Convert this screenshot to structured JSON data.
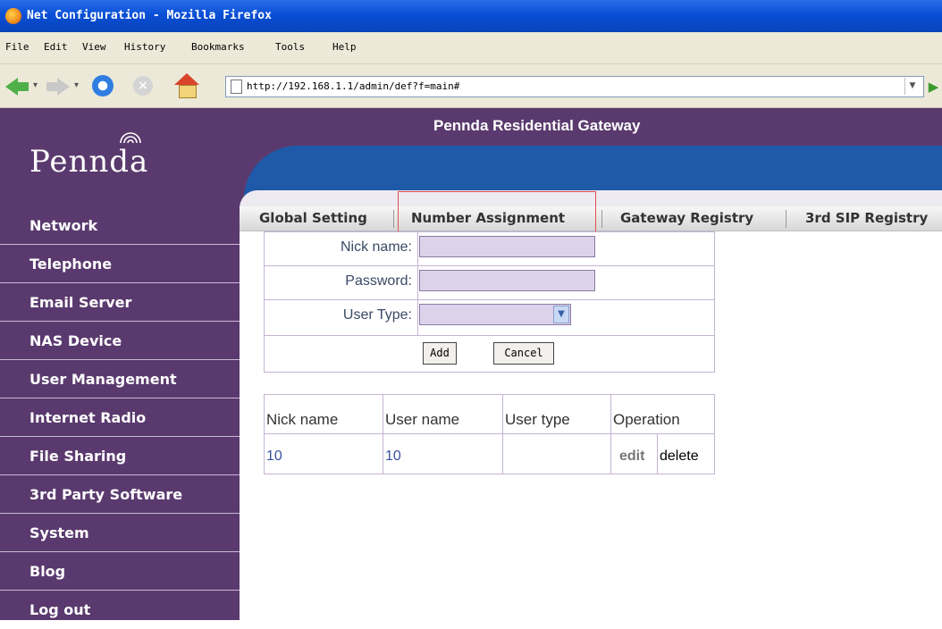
{
  "window": {
    "title": "Net Configuration - Mozilla Firefox"
  },
  "menubar": {
    "items": [
      "File",
      "Edit",
      "View",
      "History",
      "Bookmarks",
      "Tools",
      "Help"
    ]
  },
  "navbar": {
    "url": "http://192.168.1.1/admin/def?f=main#"
  },
  "header": {
    "logo": "Pennda",
    "title": "Pennda Residential Gateway"
  },
  "sidebar": {
    "items": [
      "Network",
      "Telephone",
      "Email Server",
      "NAS Device",
      "User Management",
      "Internet Radio",
      "File Sharing",
      "3rd Party Software",
      "System",
      "Blog",
      "Log out"
    ]
  },
  "tabs": {
    "items": [
      "Global Setting",
      "Number Assignment",
      "Gateway Registry",
      "3rd SIP Registry"
    ],
    "selected": "Number Assignment"
  },
  "form": {
    "nick_label": "Nick name:",
    "password_label": "Password:",
    "usertype_label": "User Type:",
    "add_label": "Add",
    "cancel_label": "Cancel",
    "nick_value": "",
    "password_value": "",
    "usertype_value": ""
  },
  "user_table": {
    "headers": [
      "Nick name",
      "User name",
      "User type",
      "Operation"
    ],
    "rows": [
      {
        "nick": "10",
        "user": "10",
        "type": "",
        "edit": "edit",
        "delete": "delete"
      }
    ]
  },
  "colors": {
    "sidebar_bg": "#5a3a6e",
    "header_band": "#1e5aa8",
    "highlight_box": "#e05050",
    "table_border": "#c4b3d4"
  }
}
